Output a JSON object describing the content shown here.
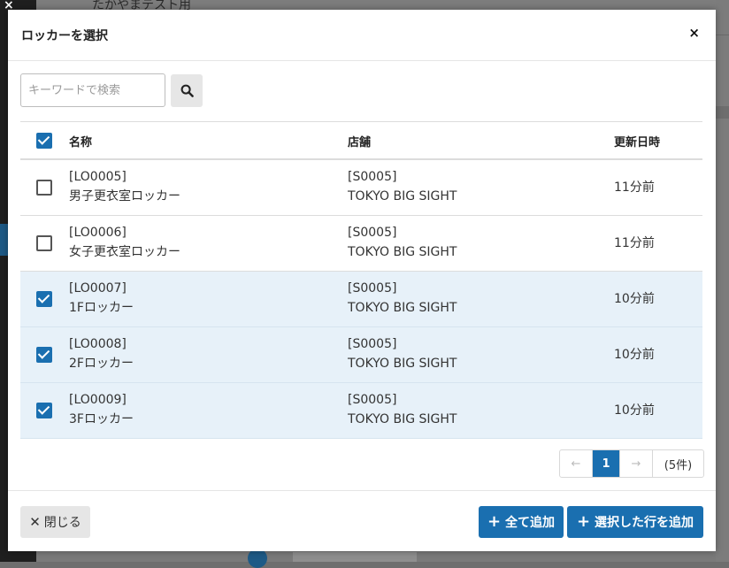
{
  "modal": {
    "title": "ロッカーを選択",
    "close_symbol": "×"
  },
  "search": {
    "placeholder": "キーワードで検索",
    "icon": "search-icon"
  },
  "table": {
    "columns": [
      "名称",
      "店舗",
      "更新日時"
    ],
    "header_checked": true,
    "rows": [
      {
        "code": "[LO0005]",
        "name": "男子更衣室ロッカー",
        "store_code": "[S0005]",
        "store_name": "TOKYO BIG SIGHT",
        "updated": "11分前",
        "checked": false
      },
      {
        "code": "[LO0006]",
        "name": "女子更衣室ロッカー",
        "store_code": "[S0005]",
        "store_name": "TOKYO BIG SIGHT",
        "updated": "11分前",
        "checked": false
      },
      {
        "code": "[LO0007]",
        "name": "1Fロッカー",
        "store_code": "[S0005]",
        "store_name": "TOKYO BIG SIGHT",
        "updated": "10分前",
        "checked": true
      },
      {
        "code": "[LO0008]",
        "name": "2Fロッカー",
        "store_code": "[S0005]",
        "store_name": "TOKYO BIG SIGHT",
        "updated": "10分前",
        "checked": true
      },
      {
        "code": "[LO0009]",
        "name": "3Fロッカー",
        "store_code": "[S0005]",
        "store_name": "TOKYO BIG SIGHT",
        "updated": "10分前",
        "checked": true
      }
    ]
  },
  "pagination": {
    "prev": "←",
    "current_page": "1",
    "next": "→",
    "total_label": "(5件)"
  },
  "footer": {
    "close_label": "閉じる",
    "add_all_label": "全て追加",
    "add_selected_label": "選択した行を追加"
  },
  "background": {
    "title_fragment": "たかやまテスト用"
  },
  "colors": {
    "accent": "#1a6fb0",
    "selected_row": "#e7f1f9"
  }
}
